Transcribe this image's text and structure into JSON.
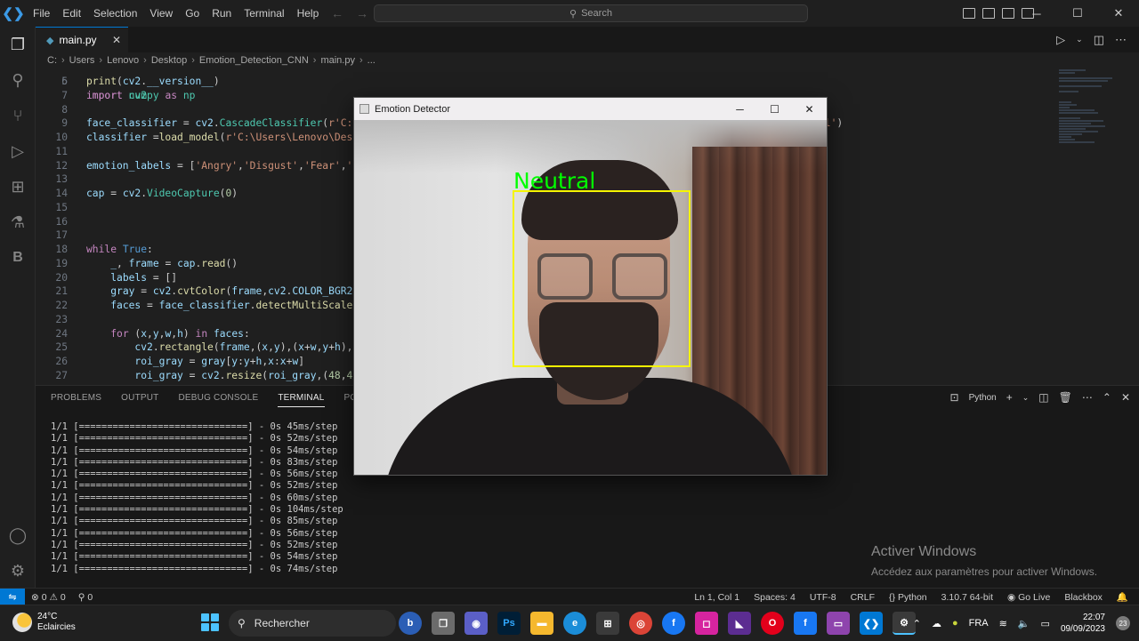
{
  "menu": [
    "File",
    "Edit",
    "Selection",
    "View",
    "Go",
    "Run",
    "Terminal",
    "Help"
  ],
  "search": {
    "placeholder": "Search"
  },
  "tab": {
    "filename": "main.py"
  },
  "breadcrumb": [
    "C:",
    "Users",
    "Lenovo",
    "Desktop",
    "Emotion_Detection_CNN",
    "main.py",
    "..."
  ],
  "code": [
    {
      "n": "6",
      "html": "<span class='fn'>print</span>(<span class='var'>cv2</span>.<span class='var'>__version__</span>)"
    },
    {
      "n": "7",
      "html": "<span class='kw'>import</span> <span class='cls'>numpy</span> <span class='kw'>as</span> <span class='cls'>np</span>"
    },
    {
      "n": "8",
      "html": ""
    },
    {
      "n": "9",
      "html": "<span class='var'>face_classifier</span> = <span class='var'>cv2</span>.<span class='cls'>CascadeClassifier</span>(<span class='str'>r'C:\\Users\\Lenovo\\Desktop\\Emotion_Detection_CNN\\haarcascade_frontalface_default.xml'</span>)"
    },
    {
      "n": "10",
      "html": "<span class='var'>classifier</span> =<span class='fn'>load_model</span>(<span class='str'>r'C:\\Users\\Lenovo\\Desktop\\Emotion_Detection_CNN\\model.h5'</span>)"
    },
    {
      "n": "11",
      "html": ""
    },
    {
      "n": "12",
      "html": "<span class='var'>emotion_labels</span> = [<span class='str'>'Angry'</span>,<span class='str'>'Disgust'</span>,<span class='str'>'Fear'</span>,<span class='str'>'Happy'</span>,<span class='str'>'Neutral'</span>,<span class='str'>'Sad'</span>,<span class='str'>'Surprise'</span>]"
    },
    {
      "n": "13",
      "html": ""
    },
    {
      "n": "14",
      "html": "<span class='var'>cap</span> = <span class='var'>cv2</span>.<span class='cls'>VideoCapture</span>(<span class='num'>0</span>)"
    },
    {
      "n": "15",
      "html": ""
    },
    {
      "n": "16",
      "html": ""
    },
    {
      "n": "17",
      "html": ""
    },
    {
      "n": "18",
      "html": "<span class='kw'>while</span> <span class='bool'>True</span>:"
    },
    {
      "n": "19",
      "html": "    <span class='var'>_</span>, <span class='var'>frame</span> = <span class='var'>cap</span>.<span class='fn'>read</span>()"
    },
    {
      "n": "20",
      "html": "    <span class='var'>labels</span> = []"
    },
    {
      "n": "21",
      "html": "    <span class='var'>gray</span> = <span class='var'>cv2</span>.<span class='fn'>cvtColor</span>(<span class='var'>frame</span>,<span class='var'>cv2</span>.<span class='var'>COLOR_BGR2GRAY</span>)"
    },
    {
      "n": "22",
      "html": "    <span class='var'>faces</span> = <span class='var'>face_classifier</span>.<span class='fn'>detectMultiScale</span>(<span class='var'>gray</span>)"
    },
    {
      "n": "23",
      "html": ""
    },
    {
      "n": "24",
      "html": "    <span class='kw'>for</span> (<span class='var'>x</span>,<span class='var'>y</span>,<span class='var'>w</span>,<span class='var'>h</span>) <span class='kw'>in</span> <span class='var'>faces</span>:"
    },
    {
      "n": "25",
      "html": "        <span class='var'>cv2</span>.<span class='fn'>rectangle</span>(<span class='var'>frame</span>,(<span class='var'>x</span>,<span class='var'>y</span>),(<span class='var'>x</span>+<span class='var'>w</span>,<span class='var'>y</span>+<span class='var'>h</span>),(<span class='num'>0</span>,<span class='num'>255</span>,<span class='num'>255</span>),<span class='num'>2</span>)"
    },
    {
      "n": "26",
      "html": "        <span class='var'>roi_gray</span> = <span class='var'>gray</span>[<span class='var'>y</span>:<span class='var'>y</span>+<span class='var'>h</span>,<span class='var'>x</span>:<span class='var'>x</span>+<span class='var'>w</span>]"
    },
    {
      "n": "27",
      "html": "        <span class='var'>roi_gray</span> = <span class='var'>cv2</span>.<span class='fn'>resize</span>(<span class='var'>roi_gray</span>,(<span class='num'>48</span>,<span class='num'>48</span>),<span class='var'>interpolation</span>=<span class='var'>cv2</span>.<span class='var'>INTER_AREA</span>)"
    }
  ],
  "panel": {
    "tabs": [
      "PROBLEMS",
      "OUTPUT",
      "DEBUG CONSOLE",
      "TERMINAL",
      "PORTS"
    ],
    "active_tab": "TERMINAL",
    "terminal_profile": "Python"
  },
  "terminal_lines": [
    "1/1 [==============================] - 0s 45ms/step",
    "1/1 [==============================] - 0s 52ms/step",
    "1/1 [==============================] - 0s 54ms/step",
    "1/1 [==============================] - 0s 83ms/step",
    "1/1 [==============================] - 0s 56ms/step",
    "1/1 [==============================] - 0s 52ms/step",
    "1/1 [==============================] - 0s 60ms/step",
    "1/1 [==============================] - 0s 104ms/step",
    "1/1 [==============================] - 0s 85ms/step",
    "1/1 [==============================] - 0s 56ms/step",
    "1/1 [==============================] - 0s 52ms/step",
    "1/1 [==============================] - 0s 54ms/step",
    "1/1 [==============================] - 0s 74ms/step"
  ],
  "activate_windows": {
    "title": "Activer Windows",
    "subtitle": "Accédez aux paramètres pour activer Windows."
  },
  "statusbar": {
    "errors": "0",
    "warnings": "0",
    "ports": "0",
    "position": "Ln 1, Col 1",
    "spaces": "Spaces: 4",
    "encoding": "UTF-8",
    "eol": "CRLF",
    "language": "Python",
    "interpreter": "3.10.7 64-bit",
    "go_live": "Go Live",
    "blackbox": "Blackbox"
  },
  "cv_window": {
    "title": "Emotion Detector",
    "emotion": "Neutral"
  },
  "taskbar": {
    "temperature": "24°C",
    "weather": "Eclaircies",
    "search": "Rechercher",
    "language": "FRA",
    "time": "22:07",
    "date": "09/09/2023",
    "notifications": "23"
  },
  "colors": {
    "accent": "#0078d4",
    "box": "#f5f500",
    "label": "#00ff00"
  }
}
